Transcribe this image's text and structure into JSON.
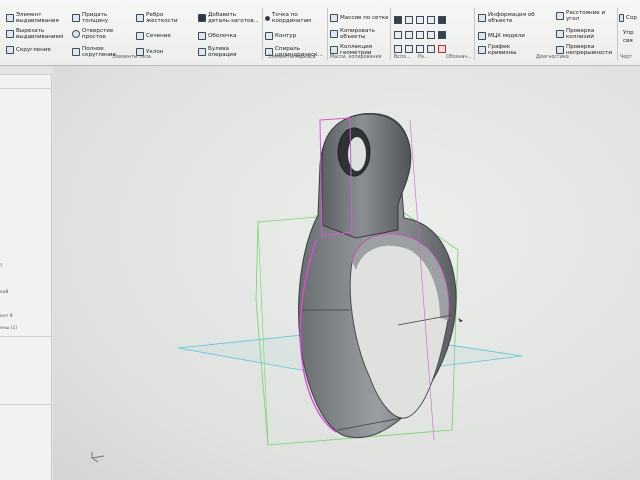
{
  "ribbon": {
    "col1": [
      "Элемент\nвыдавливания",
      "Вырезать\nвыдавливанием",
      "Скругление"
    ],
    "col2": [
      "Придать\nтолщину",
      "Отверстие\nпростое",
      "Полное\nскругление"
    ],
    "col3": [
      "Ребро\nжесткости",
      "Сечение",
      "Уклон"
    ],
    "col4": [
      "Добавить\nдеталь-заготов...",
      "Оболочка",
      "Булева\nоперация"
    ],
    "col5": [
      "Точка по\nкоординатам",
      "Контур",
      "Спираль\nцилиндрическ..."
    ],
    "col6": [
      "Массив по сетке",
      "Копировать\nобъекты",
      "Коллекция\nгеометрии"
    ],
    "col7": [
      "Информация об\nобъекте",
      "МЦХ модели",
      "График\nкривизны"
    ],
    "col8": [
      "Расстояние и\nугол",
      "Проверка\nколлизий",
      "Проверка\nнепрерывности"
    ],
    "col9": [
      "Сор",
      "Упр",
      "свя"
    ],
    "groups": {
      "body": "Элементы тела",
      "frame": "Элементы каркаса",
      "copy": "Масси. копирования",
      "aux": "Вспо...",
      "ra": "Ра...",
      "desig": "Обознач...",
      "diag": "Диагностика",
      "draw": "Черт"
    }
  },
  "left_panel": {
    "lines": [
      "?",
      "ка8",
      "ент 9",
      "ены (1)"
    ]
  }
}
